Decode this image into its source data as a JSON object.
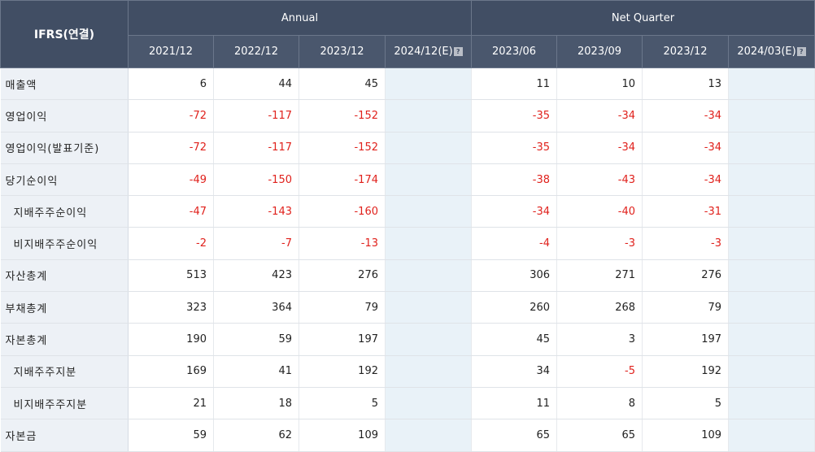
{
  "header": {
    "ifrs_label": "IFRS(연결)",
    "annual_label": "Annual",
    "quarter_label": "Net Quarter",
    "annual_periods": [
      "2021/12",
      "2022/12",
      "2023/12",
      "2024/12(E)"
    ],
    "quarter_periods": [
      "2023/06",
      "2023/09",
      "2023/12",
      "2024/03(E)"
    ],
    "estimate_icon": "help-icon",
    "estimate_icon_glyph": "?"
  },
  "colors": {
    "header_bg": "#414e64",
    "negative": "#e0211c",
    "label_bg": "#edf1f6",
    "estimate_bg": "#e9f2f8"
  },
  "rows": [
    {
      "label": "매출액",
      "indent": false,
      "annual": [
        "6",
        "44",
        "45",
        ""
      ],
      "quarter": [
        "11",
        "10",
        "13",
        ""
      ]
    },
    {
      "label": "영업이익",
      "indent": false,
      "annual": [
        "-72",
        "-117",
        "-152",
        ""
      ],
      "quarter": [
        "-35",
        "-34",
        "-34",
        ""
      ]
    },
    {
      "label": "영업이익(발표기준)",
      "indent": false,
      "annual": [
        "-72",
        "-117",
        "-152",
        ""
      ],
      "quarter": [
        "-35",
        "-34",
        "-34",
        ""
      ]
    },
    {
      "label": "당기순이익",
      "indent": false,
      "annual": [
        "-49",
        "-150",
        "-174",
        ""
      ],
      "quarter": [
        "-38",
        "-43",
        "-34",
        ""
      ]
    },
    {
      "label": "지배주주순이익",
      "indent": true,
      "annual": [
        "-47",
        "-143",
        "-160",
        ""
      ],
      "quarter": [
        "-34",
        "-40",
        "-31",
        ""
      ]
    },
    {
      "label": "비지배주주순이익",
      "indent": true,
      "annual": [
        "-2",
        "-7",
        "-13",
        ""
      ],
      "quarter": [
        "-4",
        "-3",
        "-3",
        ""
      ]
    },
    {
      "label": "자산총계",
      "indent": false,
      "annual": [
        "513",
        "423",
        "276",
        ""
      ],
      "quarter": [
        "306",
        "271",
        "276",
        ""
      ]
    },
    {
      "label": "부채총계",
      "indent": false,
      "annual": [
        "323",
        "364",
        "79",
        ""
      ],
      "quarter": [
        "260",
        "268",
        "79",
        ""
      ]
    },
    {
      "label": "자본총계",
      "indent": false,
      "annual": [
        "190",
        "59",
        "197",
        ""
      ],
      "quarter": [
        "45",
        "3",
        "197",
        ""
      ]
    },
    {
      "label": "지배주주지분",
      "indent": true,
      "annual": [
        "169",
        "41",
        "192",
        ""
      ],
      "quarter": [
        "34",
        "-5",
        "192",
        ""
      ]
    },
    {
      "label": "비지배주주지분",
      "indent": true,
      "annual": [
        "21",
        "18",
        "5",
        ""
      ],
      "quarter": [
        "11",
        "8",
        "5",
        ""
      ]
    },
    {
      "label": "자본금",
      "indent": false,
      "annual": [
        "59",
        "62",
        "109",
        ""
      ],
      "quarter": [
        "65",
        "65",
        "109",
        ""
      ]
    }
  ]
}
